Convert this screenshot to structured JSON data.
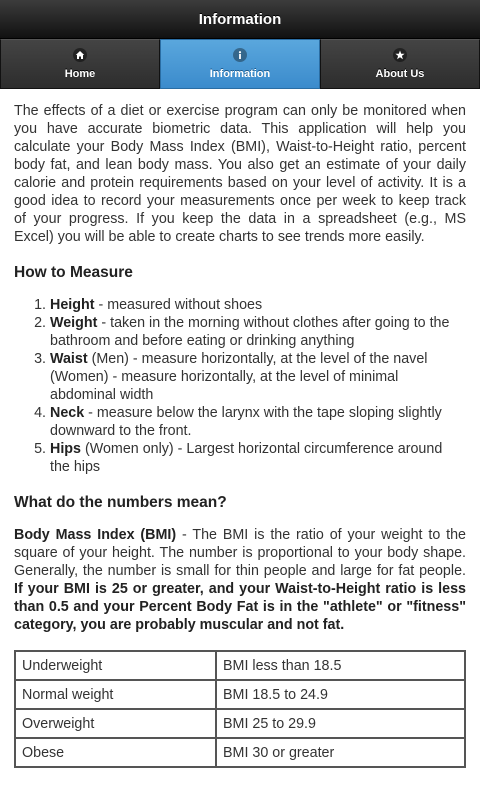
{
  "header": {
    "title": "Information"
  },
  "nav": [
    {
      "label": "Home",
      "icon": "home-icon"
    },
    {
      "label": "Information",
      "icon": "info-icon",
      "active": true
    },
    {
      "label": "About Us",
      "icon": "star-icon"
    }
  ],
  "intro": "The effects of a diet or exercise program can only be monitored when you have accurate biometric data. This application will help you calculate your Body Mass Index (BMI), Waist-to-Height ratio, percent body fat, and lean body mass. You also get an estimate of your daily calorie and protein requirements based on your level of activity. It is a good idea to record your measurements once per week to keep track of your progress. If you keep the data in a spreadsheet (e.g., MS Excel) you will be able to create charts to see trends more easily.",
  "how_to_measure": {
    "heading": "How to Measure",
    "items": [
      {
        "term": "Height",
        "text": " - measured without shoes"
      },
      {
        "term": "Weight",
        "text": " - taken in the morning without clothes after going to the bathroom and before eating or drinking anything"
      },
      {
        "term": "Waist",
        "text": " (Men) - measure horizontally, at the level of the navel (Women) - measure horizontally, at the level of minimal abdominal width"
      },
      {
        "term": "Neck",
        "text": " - measure below  the larynx with the tape sloping slightly downward to the front."
      },
      {
        "term": "Hips",
        "text": " (Women only) - Largest horizontal circumference around the hips"
      }
    ]
  },
  "numbers": {
    "heading": "What do the numbers mean?",
    "bmi_term": "Body Mass Index (BMI)",
    "bmi_text": " - The BMI is the ratio of your weight to the square of your height. The number is proportional to your body shape. Generally, the number is small for thin people and large for fat people. ",
    "bmi_bold": "If your BMI is 25 or greater, and your Waist-to-Height ratio is less than 0.5 and your Percent Body Fat is in the \"athlete\" or \"fitness\" category, you are probably muscular and not fat."
  },
  "bmi_table": [
    {
      "category": "Underweight",
      "range": "BMI less than 18.5"
    },
    {
      "category": "Normal weight",
      "range": "BMI 18.5 to 24.9"
    },
    {
      "category": "Overweight",
      "range": "BMI 25 to 29.9"
    },
    {
      "category": "Obese",
      "range": "BMI 30 or greater"
    }
  ]
}
